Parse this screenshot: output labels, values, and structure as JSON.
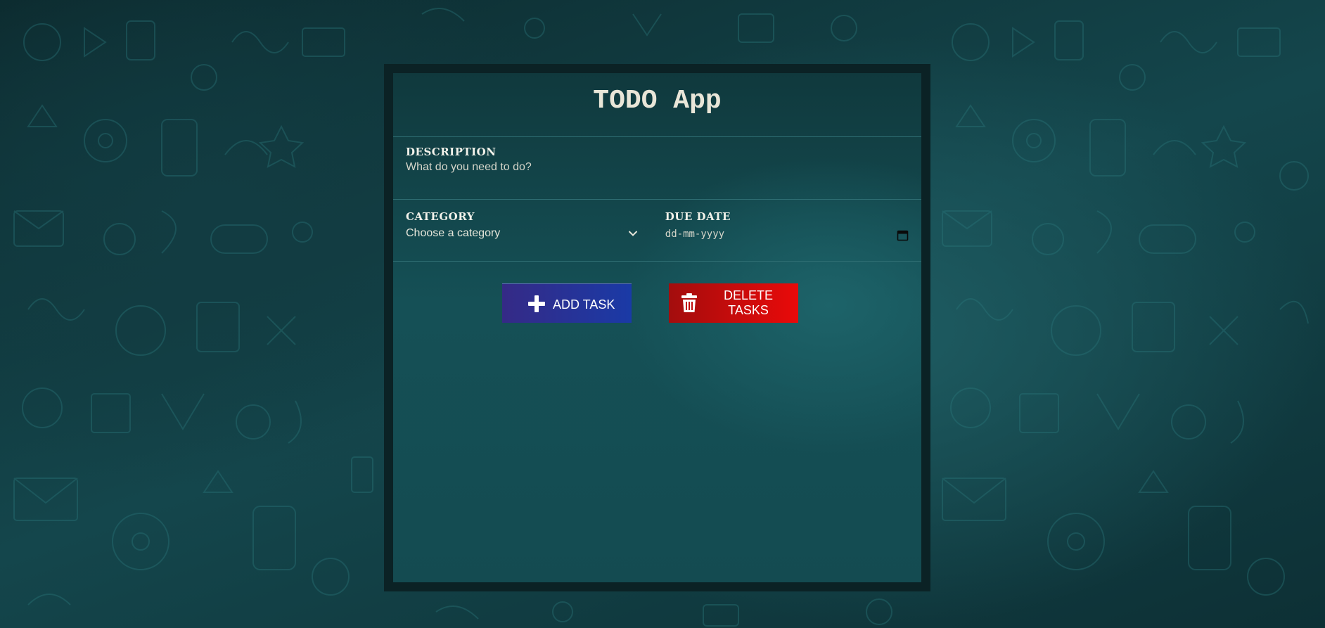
{
  "app": {
    "title": "TODO App"
  },
  "form": {
    "description": {
      "label": "DESCRIPTION",
      "placeholder": "What do you need to do?",
      "value": ""
    },
    "category": {
      "label": "CATEGORY",
      "selected": "Choose a category",
      "icon": "chevron-down-icon"
    },
    "due_date": {
      "label": "DUE DATE",
      "placeholder": "dd-mm-yyyy",
      "icon": "calendar-icon"
    }
  },
  "actions": {
    "add_label": "ADD TASK",
    "add_icon": "plus-icon",
    "delete_label": "DELETE TASKS",
    "delete_icon": "trash-icon"
  },
  "colors": {
    "add_button": "#1a3aa6",
    "delete_button": "#e90a0a",
    "panel": "#155056"
  }
}
